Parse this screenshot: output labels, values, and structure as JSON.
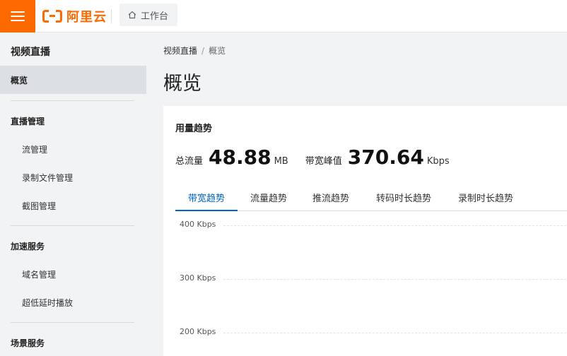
{
  "header": {
    "logo_text": "阿里云",
    "workbench_label": "工作台"
  },
  "sidebar": {
    "title": "视频直播",
    "active_item": "概览",
    "groups": [
      {
        "label": "直播管理",
        "items": [
          "流管理",
          "录制文件管理",
          "截图管理"
        ]
      },
      {
        "label": "加速服务",
        "items": [
          "域名管理",
          "超低延时播放"
        ]
      },
      {
        "label": "场景服务",
        "items": []
      }
    ]
  },
  "breadcrumb": {
    "parent": "视频直播",
    "separator": "/",
    "current": "概览"
  },
  "page_title": "概览",
  "card": {
    "title": "用量趋势",
    "total_traffic_label": "总流量",
    "total_traffic_value": "48.88",
    "total_traffic_unit": "MB",
    "peak_bandwidth_label": "带宽峰值",
    "peak_bandwidth_value": "370.64",
    "peak_bandwidth_unit": "Kbps",
    "tabs": [
      "带宽趋势",
      "流量趋势",
      "推流趋势",
      "转码时长趋势",
      "录制时长趋势"
    ],
    "active_tab": 0,
    "chart_y_ticks": [
      "400 Kbps",
      "300 Kbps",
      "200 Kbps"
    ]
  },
  "colors": {
    "brand": "#ff6a00",
    "accent": "#0064c8"
  }
}
